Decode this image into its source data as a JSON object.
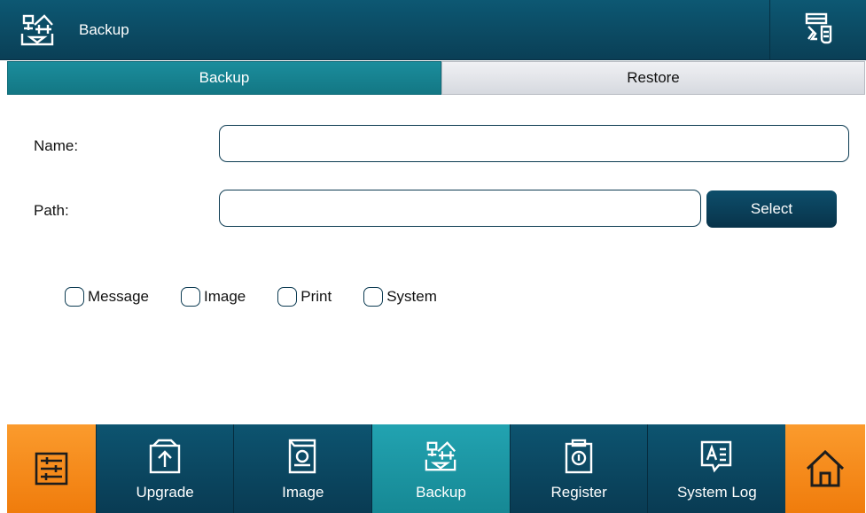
{
  "header": {
    "title": "Backup"
  },
  "tabs": [
    {
      "label": "Backup",
      "active": true
    },
    {
      "label": "Restore",
      "active": false
    }
  ],
  "form": {
    "name_label": "Name:",
    "name_value": "",
    "path_label": "Path:",
    "path_value": "",
    "select_label": "Select"
  },
  "checkboxes": [
    {
      "label": "Message",
      "checked": false
    },
    {
      "label": "Image",
      "checked": false
    },
    {
      "label": "Print",
      "checked": false
    },
    {
      "label": "System",
      "checked": false
    }
  ],
  "nav": {
    "items": [
      {
        "label": "Upgrade",
        "icon": "upgrade-icon"
      },
      {
        "label": "Image",
        "icon": "image-icon"
      },
      {
        "label": "Backup",
        "icon": "backup-icon",
        "active": true
      },
      {
        "label": "Register",
        "icon": "register-icon"
      },
      {
        "label": "System Log",
        "icon": "system-log-icon"
      }
    ]
  },
  "colors": {
    "header": "#0b4a64",
    "accent": "#1b8d9c",
    "orange": "#f58a1b",
    "dark_button": "#0a3f56"
  }
}
